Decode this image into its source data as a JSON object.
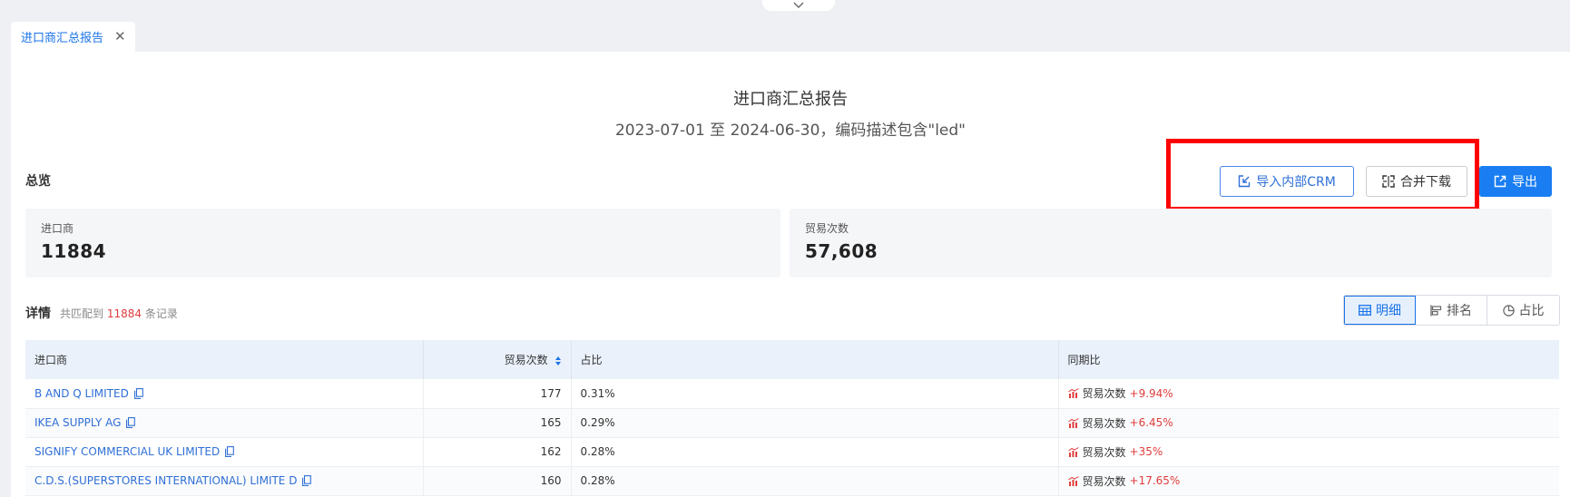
{
  "tab": {
    "label": "进口商汇总报告",
    "close": "✕"
  },
  "report": {
    "title": "进口商汇总报告",
    "subtitle": "2023-07-01 至 2024-06-30，编码描述包含\"led\""
  },
  "overview": {
    "title": "总览",
    "buttons": {
      "import_crm": "导入内部CRM",
      "merge_download": "合并下载",
      "export": "导出"
    },
    "stats": [
      {
        "label": "进口商",
        "value": "11884"
      },
      {
        "label": "贸易次数",
        "value": "57,608"
      }
    ]
  },
  "details": {
    "title": "详情",
    "count_prefix": "共匹配到",
    "count": "11884",
    "count_suffix": "条记录",
    "views": [
      "明细",
      "排名",
      "占比"
    ],
    "columns": [
      "进口商",
      "贸易次数",
      "占比",
      "同期比"
    ],
    "rows": [
      {
        "importer": "B AND Q LIMITED",
        "count": "177",
        "pct": "0.31%",
        "yoy_label": "贸易次数",
        "yoy": "+9.94%"
      },
      {
        "importer": "IKEA SUPPLY AG",
        "count": "165",
        "pct": "0.29%",
        "yoy_label": "贸易次数",
        "yoy": "+6.45%"
      },
      {
        "importer": "SIGNIFY COMMERCIAL UK LIMITED",
        "count": "162",
        "pct": "0.28%",
        "yoy_label": "贸易次数",
        "yoy": "+35%"
      },
      {
        "importer": "C.D.S.(SUPERSTORES INTERNATIONAL) LIMITE D",
        "count": "160",
        "pct": "0.28%",
        "yoy_label": "贸易次数",
        "yoy": "+17.65%"
      }
    ]
  },
  "colors": {
    "accent": "#1a7ef2",
    "highlight_box": "#ff0000",
    "positive_change": "#e03c3c"
  }
}
